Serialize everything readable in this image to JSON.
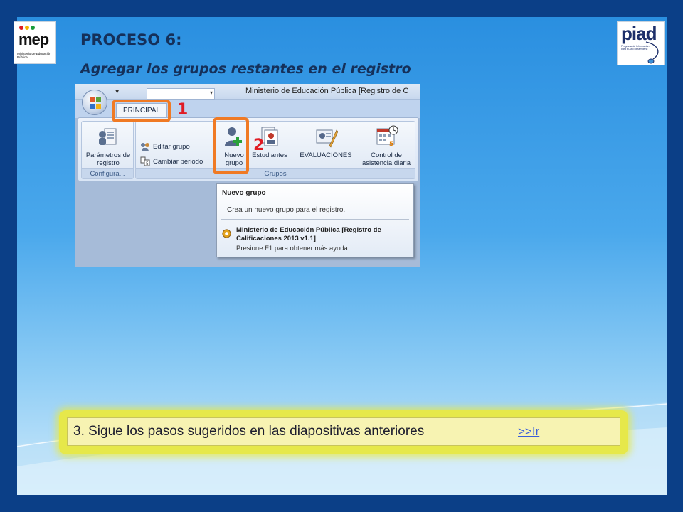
{
  "slide": {
    "title": "PROCESO 6:",
    "subtitle": "Agregar los grupos restantes en el registro"
  },
  "logos": {
    "mep": {
      "word": "mep",
      "sub": "Ministerio de Educación Pública"
    },
    "piad": {
      "word": "piad",
      "sub": "Programa de Información para el Alto Desempeño"
    }
  },
  "app": {
    "window_title": "Ministerio de Educación Pública [Registro de C",
    "tab_principal": "PRINCIPAL",
    "groups": {
      "configuracion": {
        "label": "Configura...",
        "parametros": "Parámetros de registro"
      },
      "grupos": {
        "label": "Grupos",
        "editar_grupo": "Editar grupo",
        "cambiar_periodo": "Cambiar periodo",
        "nuevo_grupo": "Nuevo grupo",
        "estudiantes": "Estudiantes",
        "evaluaciones": "EVALUACIONES",
        "control_asistencia": "Control de asistencia diaria"
      }
    },
    "tooltip": {
      "title": "Nuevo grupo",
      "description": "Crea un nuevo grupo para el registro.",
      "app_name": "Ministerio de Educación Pública [Registro de Calificaciones 2013 v1.1]",
      "help": "Presione F1 para obtener más ayuda."
    }
  },
  "annotations": {
    "step1": "1",
    "step2": "2"
  },
  "instruction": {
    "text": "3. Sigue los pasos sugeridos en las diapositivas anteriores",
    "link": ">>Ir"
  },
  "colors": {
    "background": "#0b3f87",
    "annotation_box": "#f07a24",
    "annotation_number": "#e01b24",
    "instruction_glow": "#e6e84a"
  }
}
